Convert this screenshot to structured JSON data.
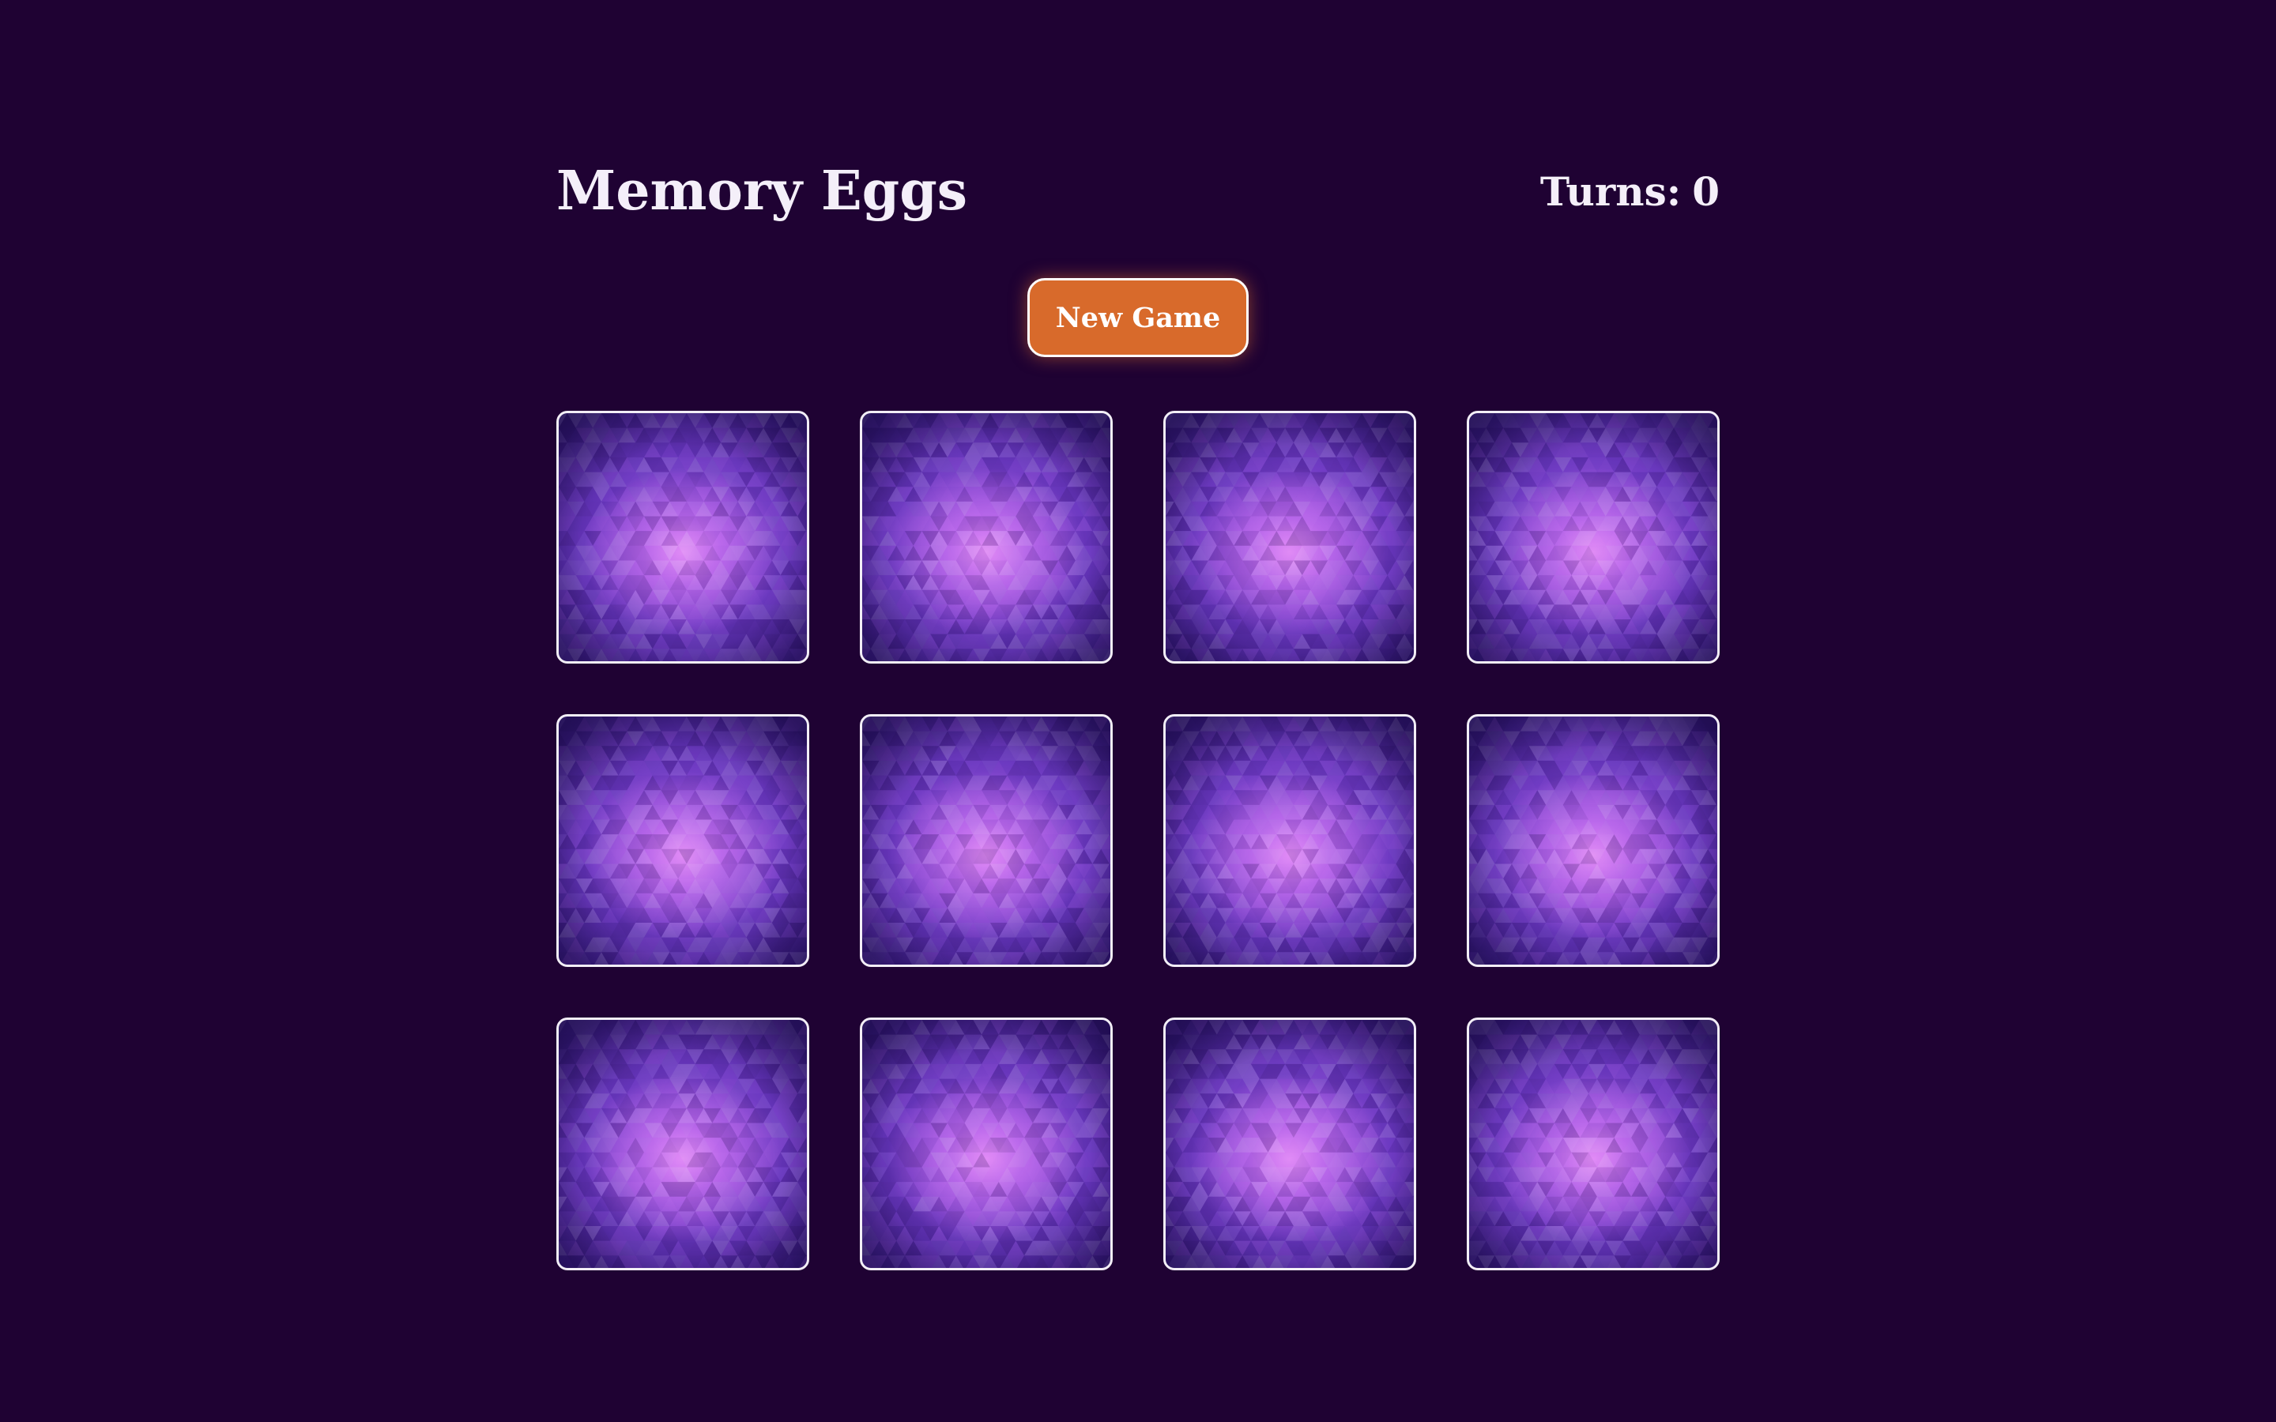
{
  "header": {
    "title": "Memory Eggs",
    "turns_label": "Turns:",
    "turns_value": "0"
  },
  "controls": {
    "new_game_label": "New Game"
  },
  "board": {
    "rows": 3,
    "columns": 4,
    "cards": [
      {
        "state": "face-down"
      },
      {
        "state": "face-down"
      },
      {
        "state": "face-down"
      },
      {
        "state": "face-down"
      },
      {
        "state": "face-down"
      },
      {
        "state": "face-down"
      },
      {
        "state": "face-down"
      },
      {
        "state": "face-down"
      },
      {
        "state": "face-down"
      },
      {
        "state": "face-down"
      },
      {
        "state": "face-down"
      },
      {
        "state": "face-down"
      }
    ]
  },
  "colors": {
    "background": "#1f0233",
    "accent": "#d86a2b",
    "text": "#f4eff9",
    "card_border": "#f2eef6"
  }
}
